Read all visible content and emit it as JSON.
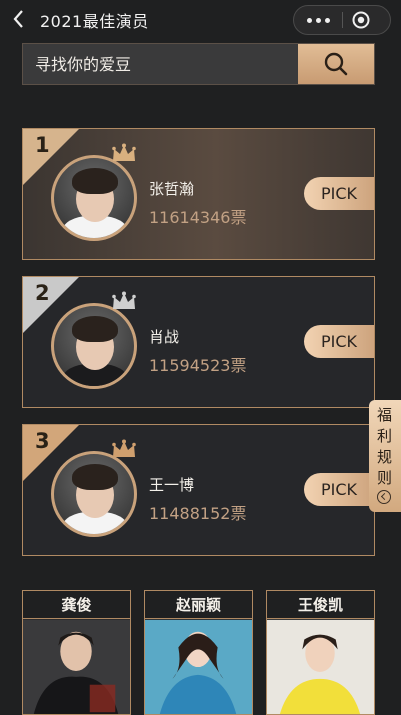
{
  "header": {
    "title": "2021最佳演员"
  },
  "search": {
    "placeholder": "寻找你的爱豆"
  },
  "ranking": [
    {
      "rank": "1",
      "name": "张哲瀚",
      "votes": "11614346票",
      "pick_label": "PICK"
    },
    {
      "rank": "2",
      "name": "肖战",
      "votes": "11594523票",
      "pick_label": "PICK"
    },
    {
      "rank": "3",
      "name": "王一博",
      "votes": "11488152票",
      "pick_label": "PICK"
    }
  ],
  "welfare": {
    "chars": [
      "福",
      "利",
      "规",
      "则"
    ]
  },
  "tiles": [
    {
      "name": "龚俊"
    },
    {
      "name": "赵丽颖"
    },
    {
      "name": "王俊凯"
    }
  ],
  "colors": {
    "background": "#1f2021",
    "gold": "#c9a27b",
    "pick_gradient_start": "#f2d3b2",
    "pick_gradient_end": "#c99e77"
  }
}
